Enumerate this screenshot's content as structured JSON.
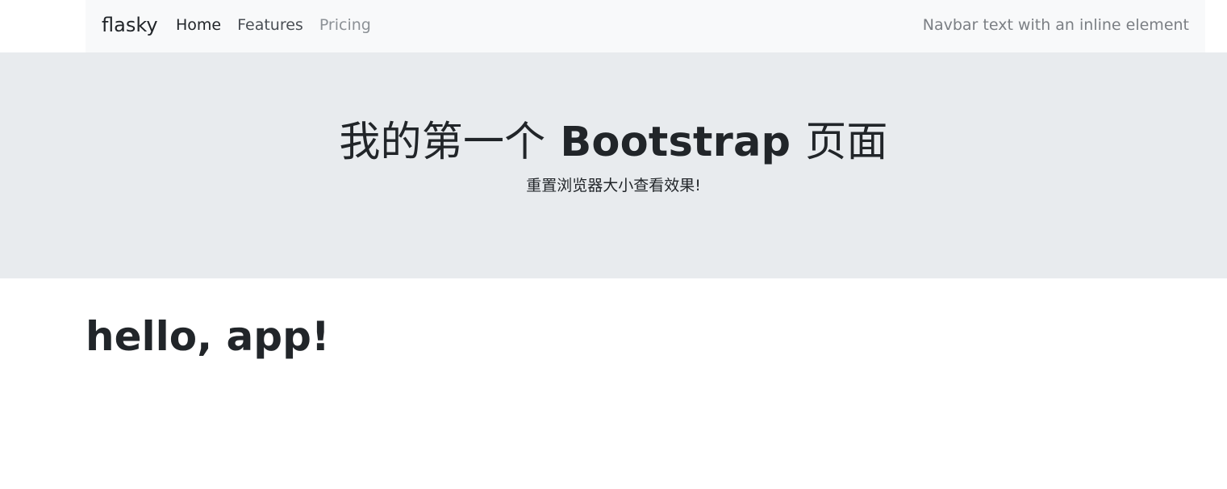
{
  "navbar": {
    "brand": "flasky",
    "links": [
      {
        "label": "Home",
        "state": "active"
      },
      {
        "label": "Features",
        "state": "normal"
      },
      {
        "label": "Pricing",
        "state": "disabled"
      }
    ],
    "text": "Navbar text with an inline element"
  },
  "hero": {
    "title_cjk_1": "我的第一个",
    "title_latin": "Bootstrap",
    "title_cjk_2": "页面",
    "subtitle": "重置浏览器大小查看效果!"
  },
  "main": {
    "heading": "hello, app!"
  },
  "colors": {
    "navbar_bg": "#f8f9fa",
    "jumbotron_bg": "#e8ebee",
    "text": "#212529",
    "muted": "#7b7f84"
  }
}
